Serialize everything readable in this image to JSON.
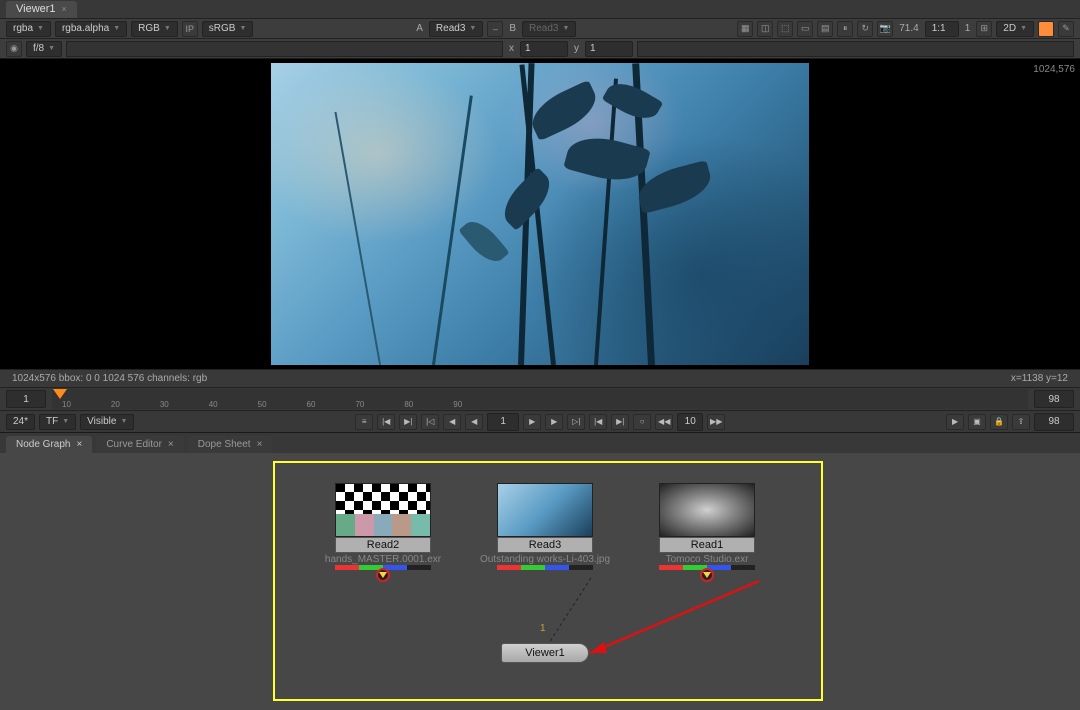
{
  "viewerTab": {
    "label": "Viewer1",
    "close": "×"
  },
  "toolbar1": {
    "channel": "rgba",
    "alpha": "rgba.alpha",
    "colorspace": "RGB",
    "lut": "sRGB",
    "abuffer": "A",
    "asrc": "Read3",
    "bbuffer": "B",
    "bsrc": "Read3",
    "zoom": "71.4",
    "ratio": "1:1",
    "one": "1",
    "mode2d": "2D"
  },
  "toolbar2": {
    "lock": "◉",
    "flabel": "f/8",
    "x": "x",
    "xval": "1",
    "y": "y",
    "yval": "1"
  },
  "resLabel": "1024,576",
  "status": {
    "left": "1024x576  bbox: 0 0 1024 576 channels: rgb",
    "right": "x=1138 y=12"
  },
  "timeline": {
    "start": "1",
    "end": "98",
    "ticks": [
      "10",
      "20",
      "30",
      "40",
      "50",
      "60",
      "70",
      "80",
      "90"
    ]
  },
  "playback": {
    "fps": "24*",
    "tf": "TF",
    "vis": "Visible",
    "curFrame": "1",
    "loopN": "10",
    "endFrame": "98"
  },
  "panelTabs": {
    "ng": "Node Graph",
    "ce": "Curve Editor",
    "ds": "Dope Sheet"
  },
  "nodes": {
    "read2": {
      "label": "Read2",
      "file": "hands_MASTER.0001.exr"
    },
    "read3": {
      "label": "Read3",
      "file": "Outstanding works-Li-403.jpg"
    },
    "read1": {
      "label": "Read1",
      "file": "Tomoco Studio.exr"
    },
    "viewer": "Viewer1",
    "connIdx": "1"
  }
}
